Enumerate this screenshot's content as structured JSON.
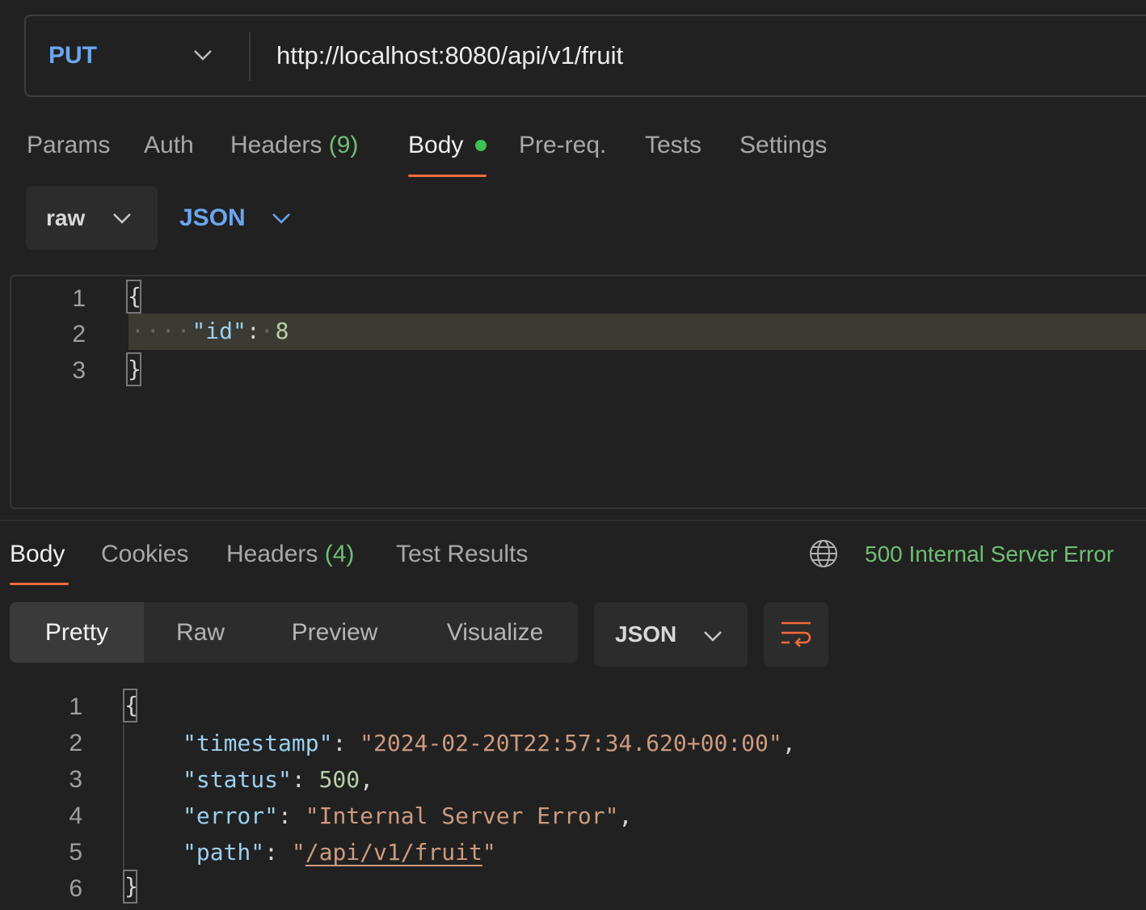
{
  "request": {
    "method": "PUT",
    "url": "http://localhost:8080/api/v1/fruit",
    "tabs": [
      {
        "label": "Params"
      },
      {
        "label": "Auth"
      },
      {
        "label": "Headers",
        "count": "(9)"
      },
      {
        "label": "Body",
        "active": true
      },
      {
        "label": "Pre-req."
      },
      {
        "label": "Tests"
      },
      {
        "label": "Settings"
      }
    ],
    "body_mode": "raw",
    "body_format": "JSON",
    "editor": {
      "line_numbers": [
        "1",
        "2",
        "3"
      ],
      "open_brace": "{",
      "close_brace": "}",
      "key": "\"id\"",
      "colon": ":",
      "value": "8"
    }
  },
  "response": {
    "tabs": [
      {
        "label": "Body",
        "active": true
      },
      {
        "label": "Cookies"
      },
      {
        "label": "Headers",
        "count": "(4)"
      },
      {
        "label": "Test Results"
      }
    ],
    "status": "500 Internal Server Error",
    "view_modes": [
      "Pretty",
      "Raw",
      "Preview",
      "Visualize"
    ],
    "active_view_mode": "Pretty",
    "format": "JSON",
    "editor": {
      "line_numbers": [
        "1",
        "2",
        "3",
        "4",
        "5",
        "6"
      ],
      "open_brace": "{",
      "close_brace": "}",
      "lines": [
        {
          "key": "\"timestamp\"",
          "value": "\"2024-02-20T22:57:34.620+00:00\"",
          "trail": ","
        },
        {
          "key": "\"status\"",
          "value": "500",
          "trail": ","
        },
        {
          "key": "\"error\"",
          "value": "\"Internal Server Error\"",
          "trail": ","
        },
        {
          "key": "\"path\"",
          "value_quote": "\"",
          "value_link": "/api/v1/fruit",
          "value_quote_end": "\""
        }
      ]
    }
  },
  "colors": {
    "accent": "#f26b3a",
    "method_blue": "#6aa6f0",
    "status_green": "#6fbf73",
    "string": "#ce9a7e",
    "key": "#9cd0f0",
    "number": "#b9cfa6"
  },
  "icons": [
    "chevron-down-icon",
    "globe-icon",
    "wrap-lines-icon"
  ]
}
